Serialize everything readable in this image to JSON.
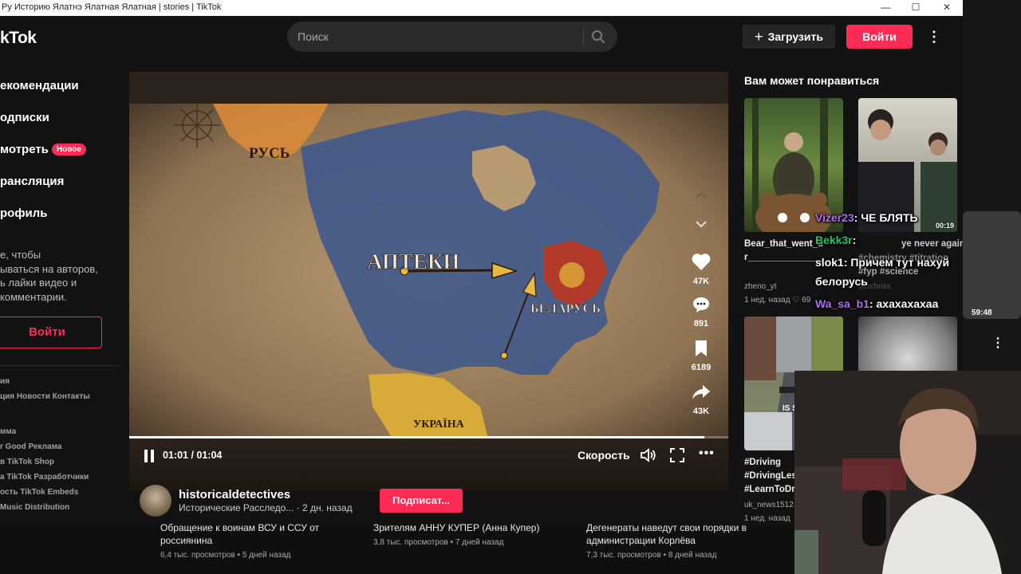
{
  "window": {
    "title": "Ру Историю Ялатнэ Ялатная Ялатная | stories | TikTok",
    "minimize": "—",
    "maximize": "☐",
    "close": "✕"
  },
  "header": {
    "logo": "kTok",
    "search_placeholder": "Поиск",
    "upload_label": "Загрузить",
    "login_label": "Войти"
  },
  "sidebar": {
    "items": [
      {
        "label": "екомендации"
      },
      {
        "label": "одписки"
      },
      {
        "label": "мотреть"
      },
      {
        "label": "рансляция"
      },
      {
        "label": "рофиль"
      }
    ],
    "new_badge": "Новое",
    "login_hint": [
      "е, чтобы",
      "ываться на авторов,",
      "ь лайки видео и",
      "комментарии."
    ],
    "login_button": "Войти",
    "footer_links": [
      "ия",
      "ция  Новости  Контакты",
      "",
      "мма",
      "r Good  Реклама",
      "в TikTok Shop",
      "а TikTok  Разработчики",
      "ость  TikTok Embeds",
      "Music Distribution"
    ]
  },
  "video": {
    "map_labels": {
      "rus": "РУСЬ",
      "apteki": "АПТЕКИ",
      "belarus": "БЕЛАРУСЬ",
      "ukraina": "УКРАЇНА"
    },
    "timecode": "01:01 / 01:04",
    "progress": 0.96,
    "speed_label": "Скорость",
    "likes": "47K",
    "comments": "891",
    "saves": "6189",
    "shares": "43K"
  },
  "author": {
    "name": "historicaldetectives",
    "desc": "Исторические Расследо... · 2 дн. назад",
    "subscribe_label": "Подписат..."
  },
  "recommendations": {
    "title": "Вам может понравиться",
    "items": [
      {
        "caption": "Bear_that_went_u",
        "caption2": "r_______________",
        "author": "zheno_yt",
        "meta": "1 нед. назад  ♡ 69"
      },
      {
        "caption": "ye never again",
        "caption2": "#chemistry #titration",
        "caption3": "#fyp #science",
        "author": "durchriss",
        "meta": "2 нед. назад",
        "duration": "00:19"
      },
      {
        "caption": "#Driving",
        "caption2": "#DrivingLes",
        "caption3": "#LearnToDr",
        "author": "uk_news15121",
        "meta": "1 нед. назад",
        "overlay": "IS S STOPPING CLU"
      },
      {
        "caption": ""
      }
    ]
  },
  "below": {
    "items": [
      {
        "title": "Обращение к воинам ВСУ и ССУ от",
        "title2": "россиянина",
        "meta": "6,4 тыс. просмотров • 5 дней назад"
      },
      {
        "title": "Зрителям АННУ КУПЕР (Анна Купер)",
        "meta": "3,8 тыс. просмотров • 7 дней назад"
      },
      {
        "title": "Дегенераты наведут свои порядки в",
        "title2": "администрации Корлёва",
        "meta": "7,3 тыс. просмотров • 8 дней назад"
      }
    ]
  },
  "chat": {
    "messages": [
      {
        "user": "Vizer23",
        "text": ": ЧЕ БЛЯТЬ",
        "color": "#b06cf0"
      },
      {
        "user": "Bekk3r",
        "text": ":",
        "color": "#22c55e"
      },
      {
        "user": "slok1",
        "text": ": Причем тут нахуй",
        "text2": "белорусь",
        "color": "#ffffff"
      },
      {
        "user": "Wa_sa_b1",
        "text": ": ахахахахаа",
        "color": "#b06cf0"
      }
    ]
  },
  "youtube": {
    "duration": "59:48"
  },
  "colors": {
    "accent": "#fe2c55",
    "background": "#121212"
  }
}
